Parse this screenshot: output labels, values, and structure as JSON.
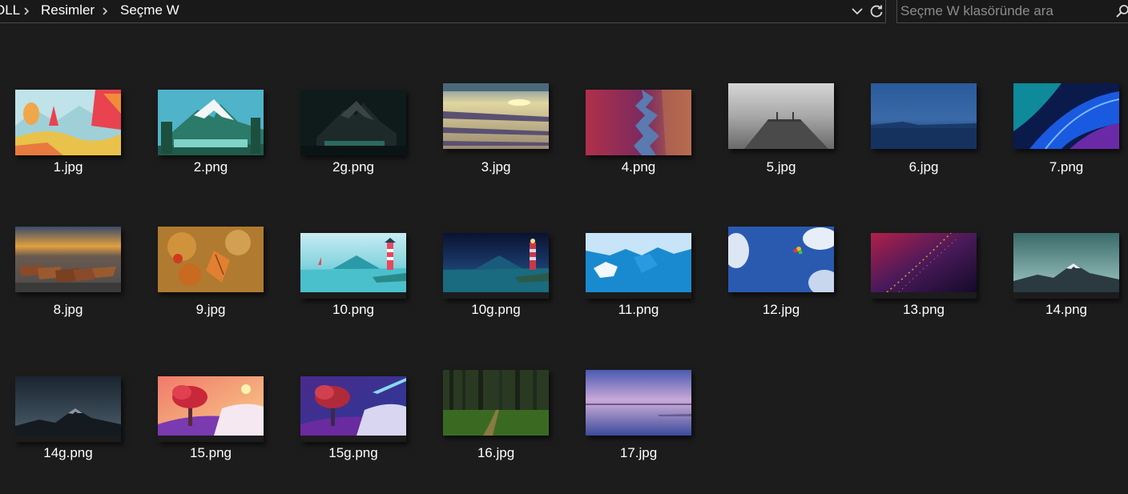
{
  "address_bar": {
    "breadcrumb": [
      "OLL",
      "Resimler",
      "Seçme W"
    ]
  },
  "search": {
    "placeholder": "Seçme W klasöründe ara"
  },
  "files": [
    {
      "name": "1.jpg"
    },
    {
      "name": "2.png"
    },
    {
      "name": "2g.png"
    },
    {
      "name": "3.jpg"
    },
    {
      "name": "4.png"
    },
    {
      "name": "5.jpg"
    },
    {
      "name": "6.jpg"
    },
    {
      "name": "7.png"
    },
    {
      "name": "8.jpg"
    },
    {
      "name": "9.jpg"
    },
    {
      "name": "10.png"
    },
    {
      "name": "10g.png"
    },
    {
      "name": "11.png"
    },
    {
      "name": "12.jpg"
    },
    {
      "name": "13.png"
    },
    {
      "name": "14.png"
    },
    {
      "name": "14g.png"
    },
    {
      "name": "15.png"
    },
    {
      "name": "15g.png"
    },
    {
      "name": "16.jpg"
    },
    {
      "name": "17.jpg"
    }
  ]
}
